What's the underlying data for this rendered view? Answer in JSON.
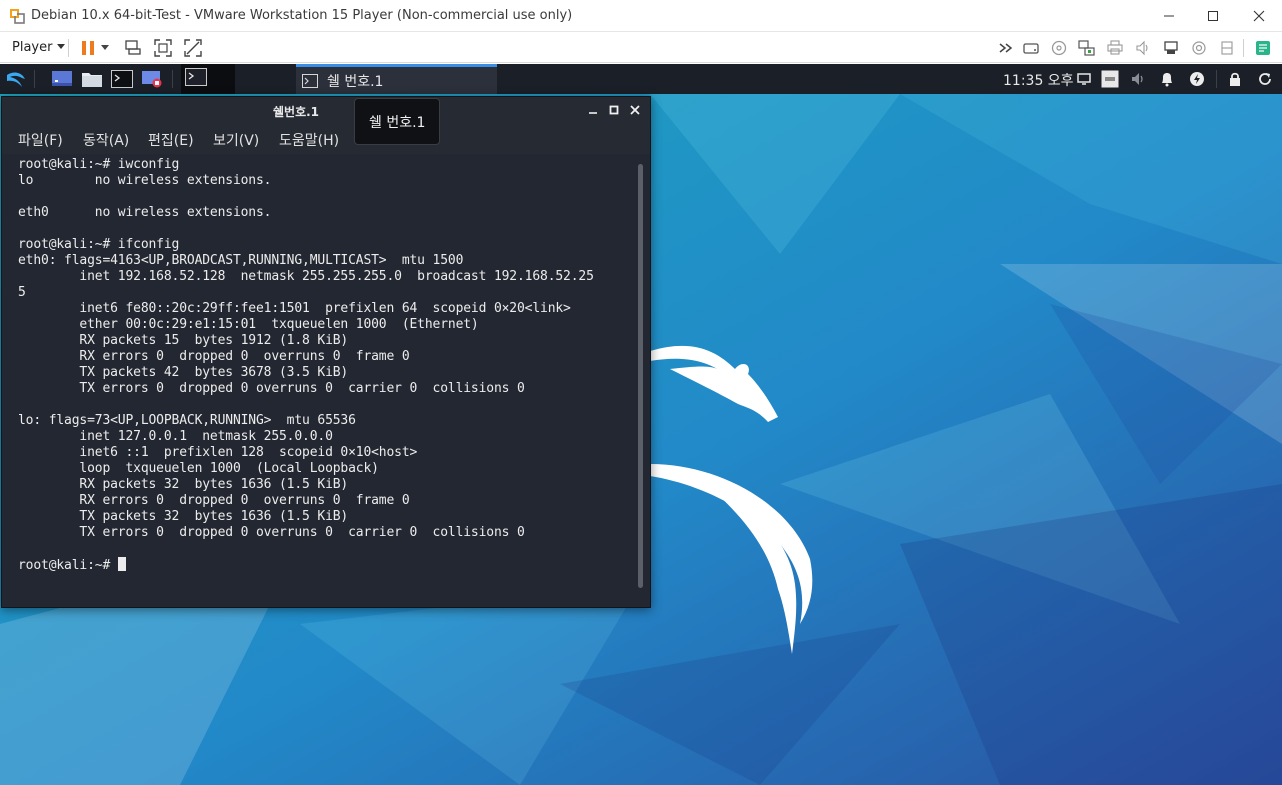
{
  "host": {
    "title": "Debian 10.x 64-bit-Test - VMware Workstation 15 Player (Non-commercial use only)",
    "player_menu_label": "Player",
    "icons": [
      "vmware-logo-icon",
      "minimize-icon",
      "maximize-icon",
      "close-icon",
      "pause-icon",
      "send-ctrl-alt-del-icon",
      "fullscreen-icon",
      "unity-icon",
      "more-icon",
      "hdd-icon",
      "cd-icon",
      "network-icon",
      "printer-icon",
      "sound-icon",
      "usb-icon",
      "camera-icon",
      "message-icon"
    ]
  },
  "kali": {
    "taskbar_label": "쉘 번호.1",
    "clock": "11:35 오후",
    "colors": {
      "panel": "#1b1f27",
      "accent": "#3a8ee6"
    }
  },
  "terminal": {
    "title": "쉘번호.1",
    "tooltip": "쉘 번호.1",
    "menus": [
      "파일(F)",
      "동작(A)",
      "편집(E)",
      "보기(V)",
      "도움말(H)"
    ],
    "lines": [
      "root@kali:~# iwconfig",
      "lo        no wireless extensions.",
      "",
      "eth0      no wireless extensions.",
      "",
      "root@kali:~# ifconfig",
      "eth0: flags=4163<UP,BROADCAST,RUNNING,MULTICAST>  mtu 1500",
      "        inet 192.168.52.128  netmask 255.255.255.0  broadcast 192.168.52.25",
      "5",
      "        inet6 fe80::20c:29ff:fee1:1501  prefixlen 64  scopeid 0×20<link>",
      "        ether 00:0c:29:e1:15:01  txqueuelen 1000  (Ethernet)",
      "        RX packets 15  bytes 1912 (1.8 KiB)",
      "        RX errors 0  dropped 0  overruns 0  frame 0",
      "        TX packets 42  bytes 3678 (3.5 KiB)",
      "        TX errors 0  dropped 0 overruns 0  carrier 0  collisions 0",
      "",
      "lo: flags=73<UP,LOOPBACK,RUNNING>  mtu 65536",
      "        inet 127.0.0.1  netmask 255.0.0.0",
      "        inet6 ::1  prefixlen 128  scopeid 0×10<host>",
      "        loop  txqueuelen 1000  (Local Loopback)",
      "        RX packets 32  bytes 1636 (1.5 KiB)",
      "        RX errors 0  dropped 0  overruns 0  frame 0",
      "        TX packets 32  bytes 1636 (1.5 KiB)",
      "        TX errors 0  dropped 0 overruns 0  carrier 0  collisions 0",
      ""
    ],
    "prompt": "root@kali:~# "
  }
}
